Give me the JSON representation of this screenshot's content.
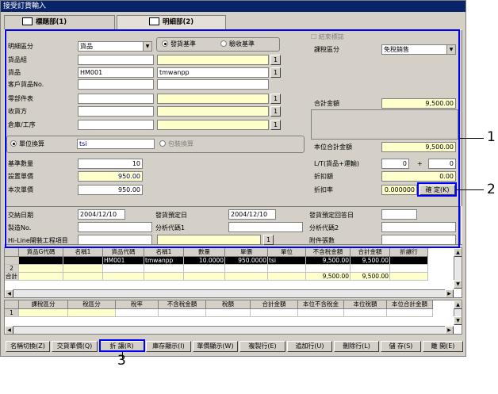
{
  "window": {
    "title": "接受訂貨輸入"
  },
  "tabs": [
    {
      "label": "標題部(1)"
    },
    {
      "label": "明細部(2)"
    }
  ],
  "form": {
    "detail_type_label": "明細區分",
    "detail_type_value": "貨品",
    "radio_ship": "發貨基準",
    "radio_receive": "驗收基準",
    "end_flag_label": "結束標誌",
    "tax_type_label": "課稅區分",
    "tax_type_value": "免稅銷售",
    "item_group_label": "貨品組",
    "item_label": "貨品",
    "item_code": "HM001",
    "item_name": "tmwanpp",
    "customer_item_label": "客戶貨品No.",
    "parts_table_label": "零部件表",
    "receiver_label": "收貨方",
    "warehouse_label": "倉庫/工序",
    "total_amount_label": "合計金額",
    "total_amount_value": "9,500.00",
    "unit_conv_label": "單位換算",
    "unit_conv_value": "tsi",
    "pack_conv_label": "包裝換算",
    "unit_total_label": "本位合計金額",
    "unit_total_value": "9,500.00",
    "base_qty_label": "基準數量",
    "base_qty_value": "10",
    "set_price_label": "設置單價",
    "set_price_value": "950.00",
    "current_price_label": "本次單價",
    "current_price_value": "950.00",
    "lt_label": "L/T(貨品+運輸)",
    "lt_value1": "0",
    "lt_plus": "+",
    "lt_value2": "0",
    "discount_label": "折扣額",
    "discount_value": "0.00",
    "discount_rate_label": "折扣率",
    "discount_rate_value": "0.000000",
    "confirm_button": "確 定(K)",
    "lookup_button": "1"
  },
  "lower_form": {
    "delivery_date_label": "交納日期",
    "delivery_date_value": "2004/12/10",
    "ship_plan_label": "發貨預定日",
    "ship_plan_value": "2004/12/10",
    "ship_reply_label": "發貨預定回答日",
    "mfg_no_label": "製造No.",
    "analysis1_label": "分析代碼1",
    "analysis2_label": "分析代碼2",
    "hiline_label": "Hi-Line開裝工程項目",
    "attachments_label": "附件張數"
  },
  "grid1": {
    "headers": [
      "貨品G代碼",
      "名稱1",
      "貨品代碼",
      "名稱1",
      "數量",
      "單價",
      "單位",
      "不含稅金額",
      "合計金額",
      "折讓行"
    ],
    "rows": [
      {
        "no": "",
        "cells": [
          "",
          "",
          "HM001",
          "tmwanpp",
          "10.0000",
          "950.0000",
          "tsi",
          "9,500.00",
          "9,500.00",
          ""
        ]
      },
      {
        "no": "2",
        "cells": [
          "",
          "",
          "",
          "",
          "",
          "",
          "",
          "",
          "",
          ""
        ]
      }
    ],
    "total_label": "合計",
    "total_cells": [
      "",
      "",
      "",
      "",
      "",
      "",
      "",
      "9,500.00",
      "9,500.00",
      ""
    ]
  },
  "grid2": {
    "headers": [
      "課稅區分",
      "稅區分",
      "稅率",
      "不含稅金額",
      "稅額",
      "合計金額",
      "本位不含稅金",
      "本位稅額",
      "本位合計金額"
    ],
    "rows": [
      {
        "no": "1",
        "cells": [
          "",
          "",
          "",
          "",
          "",
          "",
          "",
          "",
          ""
        ]
      }
    ]
  },
  "buttons": [
    "名稱切換(Z)",
    "交貨單價(Q)",
    "折 讓(R)",
    "庫存顯示(I)",
    "單價顯示(W)",
    "複製行(E)",
    "追加行(U)",
    "刪除行(L)",
    "儲 存(S)",
    "離 開(E)"
  ],
  "callouts": [
    "1",
    "2",
    "3"
  ]
}
